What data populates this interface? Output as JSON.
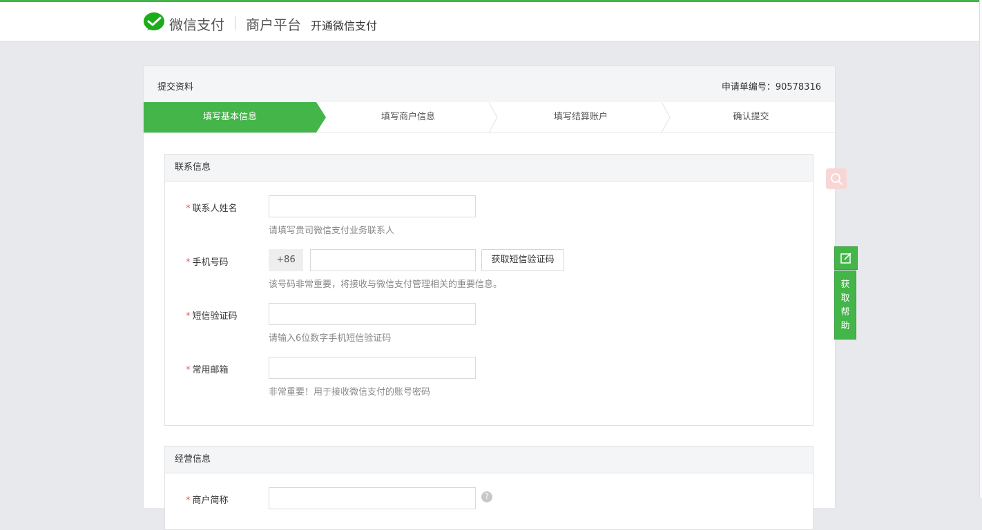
{
  "header": {
    "logo_text": "微信支付",
    "platform": "商户平台",
    "open_pay": "开通微信支付"
  },
  "card": {
    "title": "提交资料",
    "application_no_label": "申请单编号：90578316"
  },
  "steps": [
    {
      "label": "填写基本信息",
      "active": true
    },
    {
      "label": "填写商户信息",
      "active": false
    },
    {
      "label": "填写结算账户",
      "active": false
    },
    {
      "label": "确认提交",
      "active": false
    }
  ],
  "contact": {
    "title": "联系信息",
    "required_mark": "*",
    "name": {
      "label": "联系人姓名",
      "hint": "请填写贵司微信支付业务联系人",
      "value": ""
    },
    "phone": {
      "label": "手机号码",
      "prefix": "+86",
      "button": "获取短信验证码",
      "hint": "该号码非常重要，将接收与微信支付管理相关的重要信息。",
      "value": ""
    },
    "sms": {
      "label": "短信验证码",
      "hint": "请输入6位数字手机短信验证码",
      "value": ""
    },
    "email": {
      "label": "常用邮箱",
      "hint": "非常重要！用于接收微信支付的账号密码",
      "value": ""
    }
  },
  "business": {
    "title": "经营信息",
    "short_name": {
      "label": "商户简称",
      "help": "?",
      "value": ""
    }
  },
  "help_widget": {
    "chars": [
      "获",
      "取",
      "帮",
      "助"
    ]
  },
  "colors": {
    "brand_green": "#44b549",
    "required_red": "#e15f63"
  }
}
